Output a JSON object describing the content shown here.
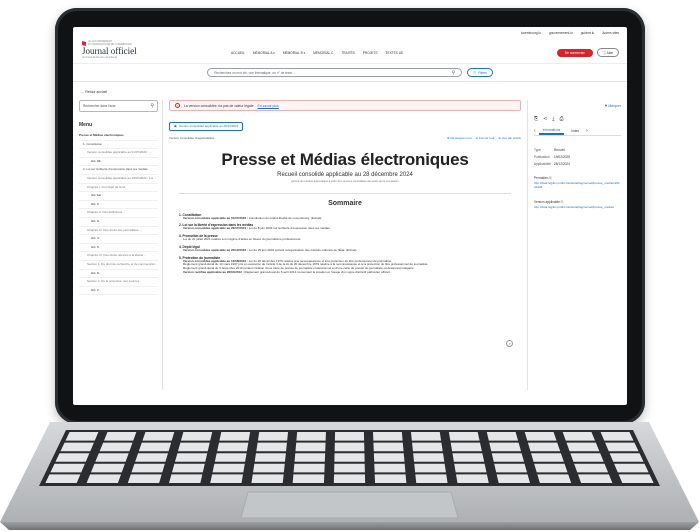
{
  "topbar": {
    "links": [
      "luxembourg.lu",
      "gouvernement.lu",
      "guichet.lu",
      "Autres sites"
    ]
  },
  "header": {
    "gov_line1": "LE GOUVERNEMENT",
    "gov_line2": "DU GRAND-DUCHÉ DE LUXEMBOURG",
    "title": "Journal officiel",
    "subtitle": "du Grand-Duché de Luxembourg",
    "nav": [
      "ACCUEIL",
      "MÉMORIAL A ▾",
      "MÉMORIAL B ▾",
      "MÉMORIAL C",
      "TRAITÉS",
      "PROJETS",
      "TEXTES UE"
    ],
    "login_label": "Se connecter",
    "help_label": "ⓘ Aide"
  },
  "search": {
    "placeholder": "Recherchez un mot clé, une thématique, un n° de texte...",
    "filters_label": "Filtres"
  },
  "back_label": "Retour accueil",
  "sidebar": {
    "search_placeholder": "Rechercher dans l'acte",
    "menu_title": "Menu",
    "items": [
      {
        "label": "Presse et Médias électroniques",
        "level": 0
      },
      {
        "label": "1. Constitution",
        "level": 1
      },
      {
        "label": "Version consolidée applicable au 01/07/2023 : ...",
        "level": 2
      },
      {
        "label": "Art. 23.",
        "level": 3
      },
      {
        "label": "2. Loi sur la liberté d'expression dans les médias",
        "level": 1
      },
      {
        "label": "Version consolidée applicable au 26/07/2024 : Loi ...",
        "level": 2
      },
      {
        "label": "Chapitre I. Du l'objet de la loi",
        "level": 2
      },
      {
        "label": "Art. 1er .",
        "level": 3
      },
      {
        "label": "Art. 2.",
        "level": 3
      },
      {
        "label": "Chapitre II. Des définitions",
        "level": 2
      },
      {
        "label": "Art. 3.",
        "level": 3
      },
      {
        "label": "Chapitre III. Des droits des journalistes ...",
        "level": 2
      },
      {
        "label": "Art. 4.",
        "level": 3
      },
      {
        "label": "Art. 5.",
        "level": 3
      },
      {
        "label": "Chapitre IV. Des droits relevant à la liberté ...",
        "level": 2
      },
      {
        "label": "Section 1. Du droit de recherche et de communicat ...",
        "level": 2
      },
      {
        "label": "Art. 6.",
        "level": 3
      },
      {
        "label": "Section 2. De la protection des sources",
        "level": 2
      },
      {
        "label": "Art. 7.",
        "level": 3
      }
    ]
  },
  "content": {
    "alert_text": "La version consolidée n'a pas de valeur légale",
    "alert_link": "En savoir plus",
    "version_tag": "Version consolidée applicable au 28/12/2024",
    "versions_label": "Version consolidée d'applicabilités",
    "actions": [
      "Développer tout",
      "Fermer tout",
      "Vue par article"
    ],
    "title": "Presse et Médias électroniques",
    "subtitle": "Recueil consolidé applicable au 28 décembre 2024",
    "note": "généré de manière automatique à partir des versions consolidées des actes qui le composent",
    "sommaire_title": "Sommaire",
    "sommaire": [
      {
        "h": "1. Constitution",
        "lines": [
          {
            "b": "Version consolidée applicable au 01/07/2023 :",
            "t": " Constitution du Grand-Duché de Luxembourg. (Extrait)"
          }
        ]
      },
      {
        "h": "2. Loi sur la liberté d'expression dans les médias",
        "lines": [
          {
            "b": "Version consolidée applicable au 26/07/2024 :",
            "t": " Loi du 8 juin 2004 sur la liberté d'expression dans les médias."
          }
        ]
      },
      {
        "h": "3. Promotion de la presse",
        "lines": [
          {
            "b": "",
            "t": "Loi du 20 juillet 2021 relative à un régime d'aides en faveur du journalisme professionnel."
          }
        ]
      },
      {
        "h": "4. Dépôt légal",
        "lines": [
          {
            "b": "Version consolidée applicable au 23/12/2023 :",
            "t": " Loi du 25 juin 2004 portant réorganisation des instituts culturels de l'État. (Extrait)"
          }
        ]
      },
      {
        "h": "5. Protection du journaliste",
        "lines": [
          {
            "b": "Version consolidée applicable au 12/08/2004 :",
            "t": " Loi du 20 décembre 1979 relative à la reconnaissance et à la protection du titre professionnel de journaliste."
          },
          {
            "b": "",
            "t": "Règlement grand-ducal du 13 mars 1997 pris en exécution de l'article 3 de la loi du 20 décembre 1979 relative à la reconnaissance et à la protection du titre professionnel de journaliste."
          },
          {
            "b": "",
            "t": "Règlement grand-ducal du 9 décembre 2010 portant création d'une carte de presse de journaliste professionnel et d'une carte de presse de journaliste professionnel stagiaire."
          },
          {
            "b": "Version rectifiée applicable au 26/04/2012 :",
            "t": " Règlement grand-ducal du 6 avril 2013 concernant la création et l'usage d'un signe distinctif particulier officiel..."
          }
        ]
      }
    ]
  },
  "right_panel": {
    "bookmark_label": "Marquer",
    "tabs": [
      "Informations",
      "Index"
    ],
    "type_key": "Type",
    "type_val": "Recueil",
    "pub_key": "Publication",
    "pub_val": "19/02/2025",
    "app_key": "Applicabilité",
    "app_val": "28/12/2024",
    "permalink_label": "Permalien",
    "permalink_url": "http://data.legilux.public.lu/eli/etat/leg/recueil/presse_medias/20241228",
    "version_label": "Version applicable",
    "version_url": "http://data.legilux.public.lu/eli/etat/leg/recueil/presse_medias"
  }
}
